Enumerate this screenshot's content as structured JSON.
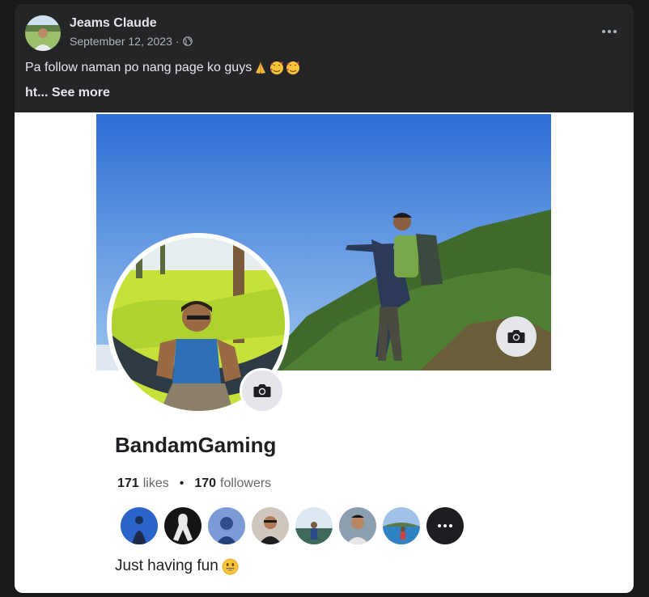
{
  "post": {
    "author": "Jeams Claude",
    "date": "September 12, 2023",
    "separator": "·",
    "audience_icon": "globe-icon",
    "more_icon": "ellipsis-icon",
    "caption": "Pa follow naman po nang page ko guys",
    "caption_emojis": [
      "folded-hands-emoji",
      "smiling-face-with-hearts-emoji",
      "smiling-face-with-hearts-emoji"
    ],
    "caption_line2": "ht...",
    "see_more": "See more"
  },
  "screenshot": {
    "page_name": "BandamGaming",
    "likes_count": "171",
    "likes_label": "likes",
    "bullet": "•",
    "followers_count": "170",
    "followers_label": "followers",
    "bio": "Just having fun",
    "bio_emoji": "grinning-face-emoji",
    "friend_avatars_count": 7,
    "more_friends_icon": "ellipsis-icon",
    "camera_icon": "camera-icon"
  },
  "colors": {
    "card_bg": "#242526",
    "page_bg": "#18191a",
    "text_primary": "#e4e6eb",
    "text_secondary": "#b0b3b8"
  }
}
